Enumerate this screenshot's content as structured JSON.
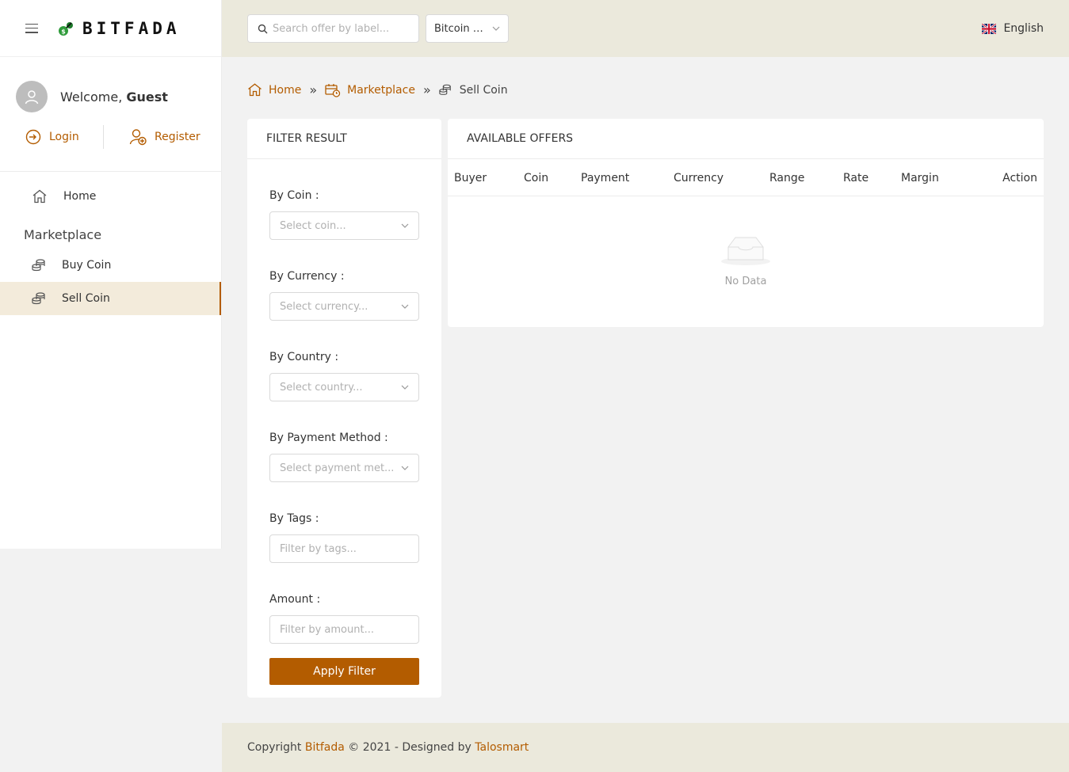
{
  "brand": {
    "name": "BITFADA"
  },
  "user": {
    "welcome": "Welcome,",
    "name": "Guest",
    "login_label": "Login",
    "register_label": "Register"
  },
  "sidebar": {
    "home_label": "Home",
    "group_label": "Marketplace",
    "items": [
      {
        "label": "Buy Coin",
        "active": false
      },
      {
        "label": "Sell Coin",
        "active": true
      }
    ]
  },
  "topbar": {
    "search_placeholder": "Search offer by label...",
    "coin_value": "Bitcoin C...",
    "language": "English"
  },
  "breadcrumb": {
    "home": "Home",
    "marketplace": "Marketplace",
    "current": "Sell Coin",
    "separator": "»"
  },
  "filter": {
    "title": "FILTER RESULT",
    "coin_label": "By Coin :",
    "coin_placeholder": "Select coin...",
    "currency_label": "By Currency :",
    "currency_placeholder": "Select currency...",
    "country_label": "By Country :",
    "country_placeholder": "Select country...",
    "payment_label": "By Payment Method :",
    "payment_placeholder": "Select payment met...",
    "tags_label": "By Tags :",
    "tags_placeholder": "Filter by tags...",
    "amount_label": "Amount :",
    "amount_placeholder": "Filter by amount...",
    "apply_label": "Apply Filter"
  },
  "offers": {
    "title": "AVAILABLE OFFERS",
    "columns": [
      "Buyer",
      "Coin",
      "Payment",
      "Currency",
      "Range",
      "Rate",
      "Margin",
      "Action"
    ],
    "empty_text": "No Data"
  },
  "footer": {
    "copyright": "Copyright",
    "brand_link": "Bitfada",
    "middle": "© 2021 - Designed by",
    "designer_link": "Talosmart"
  },
  "colors": {
    "accent": "#b35c00",
    "topbar": "#ebe9dc",
    "active_bg": "#f3ebdb"
  }
}
